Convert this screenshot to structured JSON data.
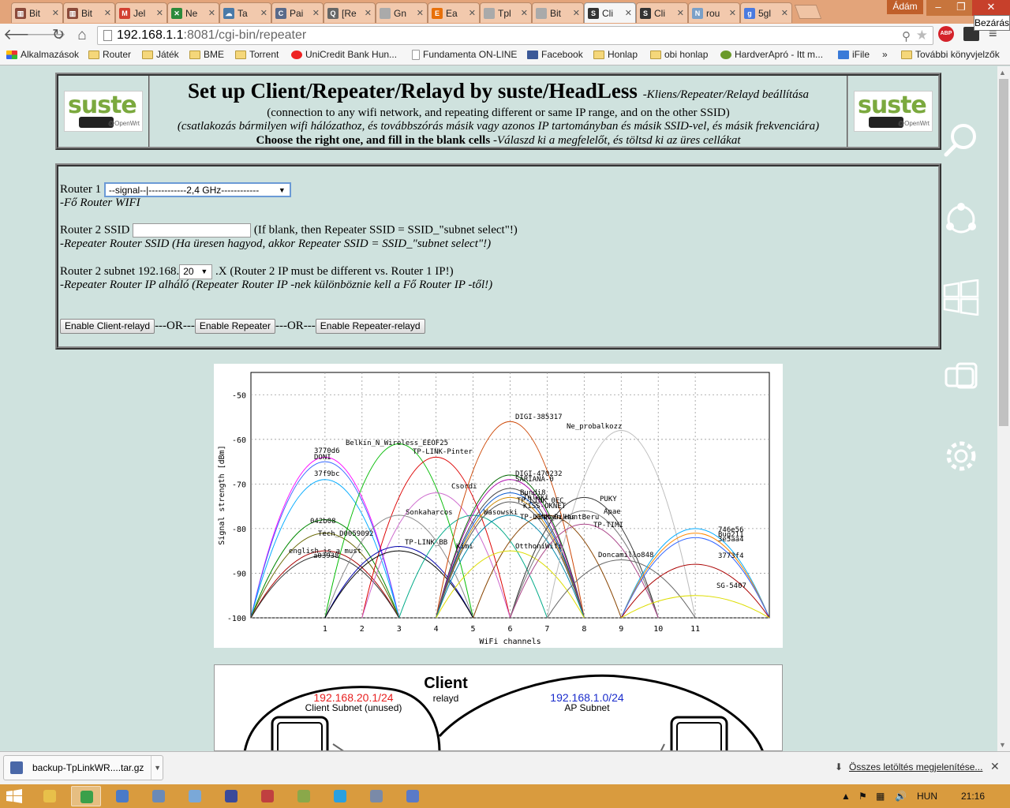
{
  "tabs": [
    {
      "label": "Bit",
      "color": "#8b4a3a",
      "glyph": "▥"
    },
    {
      "label": "Bit",
      "color": "#8b4a3a",
      "glyph": "▥"
    },
    {
      "label": "Jel",
      "color": "#d23f31",
      "glyph": "M"
    },
    {
      "label": "Ne",
      "color": "#2a8a3a",
      "glyph": "✕"
    },
    {
      "label": "Ta",
      "color": "#4a7aa8",
      "glyph": "☁"
    },
    {
      "label": "Pai",
      "color": "#5a6a8a",
      "glyph": "C"
    },
    {
      "label": "[Re",
      "color": "#666666",
      "glyph": "Q"
    },
    {
      "label": "Gn",
      "color": "#aaaaaa",
      "glyph": ""
    },
    {
      "label": "Ea",
      "color": "#e8700a",
      "glyph": "E"
    },
    {
      "label": "Tpl",
      "color": "#aaaaaa",
      "glyph": ""
    },
    {
      "label": "Bit",
      "color": "#aaaaaa",
      "glyph": ""
    },
    {
      "label": "Cli",
      "color": "#333333",
      "glyph": "S",
      "active": true
    },
    {
      "label": "Cli",
      "color": "#333333",
      "glyph": "S"
    },
    {
      "label": "rou",
      "color": "#7aa0c8",
      "glyph": "N"
    },
    {
      "label": "5gl",
      "color": "#4a7ae0",
      "glyph": "g"
    }
  ],
  "window": {
    "user": "Ádám",
    "close_tooltip": "Bezárás",
    "min": "–",
    "max": "❐",
    "close": "✕"
  },
  "toolbar": {
    "back": "🡐",
    "forward": "🡒",
    "reload": "↻",
    "home": "⌂",
    "url_host": "192.168.1.1",
    "url_rest": ":8081/cgi-bin/repeater",
    "abp": "ABP"
  },
  "bookmarks": [
    {
      "label": "Alkalmazások",
      "type": "apps"
    },
    {
      "label": "Router",
      "type": "folder"
    },
    {
      "label": "Játék",
      "type": "folder"
    },
    {
      "label": "BME",
      "type": "folder"
    },
    {
      "label": "Torrent",
      "type": "folder"
    },
    {
      "label": "UniCredit Bank Hun...",
      "type": "unicredit"
    },
    {
      "label": "Fundamenta ON-LINE",
      "type": "page"
    },
    {
      "label": "Facebook",
      "type": "facebook"
    },
    {
      "label": "Honlap",
      "type": "folder"
    },
    {
      "label": "obi honlap",
      "type": "folder"
    },
    {
      "label": "HardverApró - Itt m...",
      "type": "hardver"
    },
    {
      "label": "iFile",
      "type": "ifile"
    },
    {
      "label": "»",
      "type": "more"
    },
    {
      "label": "További könyvjelzők",
      "type": "folder"
    }
  ],
  "header": {
    "title": "Set up Client/Repeater/Relayd by suste/HeadLess",
    "title_sub": "-Kliens/Repeater/Relayd beállítása",
    "line1": "(connection to any wifi network, and repeating different or same IP range, and on the other SSID)",
    "line2": "(csatlakozás bármilyen wifi hálózathoz, és továbbszórás másik vagy azonos IP tartományban és másik SSID-vel, és másik frekvenciára)",
    "choose": "Choose the right one, and fill in the blank cells",
    "choose_sub": "-Válaszd ki a megfelelőt, és töltsd ki az üres cellákat",
    "logo_text": "suste",
    "logo_sub": "@OpenWrt"
  },
  "form": {
    "router1_label": "Router 1",
    "router1_value": "--signal--|------------2,4 GHz------------",
    "router1_hint": "-Fő Router WIFI",
    "ssid_label": "Router 2 SSID",
    "ssid_value": "",
    "ssid_note": "(If blank, then Repeater SSID = SSID_\"subnet select\"!)",
    "ssid_hint": "-Repeater Router SSID (Ha üresen hagyod, akkor Repeater SSID = SSID_\"subnet select\"!)",
    "subnet_label": "Router 2 subnet 192.168.",
    "subnet_value": "20",
    "subnet_note": ".X (Router 2 IP must be different vs. Router 1 IP!)",
    "subnet_hint": "-Repeater Router IP alháló (Repeater Router IP -nek különböznie kell a Fő Router IP -től!)",
    "btn_client": "Enable Client-relayd",
    "or1": "---OR---",
    "btn_repeater": "Enable Repeater",
    "or2": "---OR---",
    "btn_repeater_relayd": "Enable Repeater-relayd"
  },
  "chart_data": {
    "type": "line",
    "title": "",
    "xlabel": "WiFi channels",
    "ylabel": "Signal strength [dBm]",
    "xlim": [
      -1,
      13
    ],
    "ylim": [
      -100,
      -45
    ],
    "xticks": [
      1,
      2,
      3,
      4,
      5,
      6,
      7,
      8,
      9,
      10,
      11
    ],
    "yticks": [
      -50,
      -60,
      -70,
      -80,
      -90,
      -100
    ],
    "grid": true,
    "series": [
      {
        "name": "3770d6",
        "channel": 1,
        "peak": -64,
        "color": "#ff00ff"
      },
      {
        "name": "DONI",
        "channel": 1,
        "peak": -65,
        "color": "#3366ff"
      },
      {
        "name": "37f9bc",
        "channel": 1,
        "peak": -69,
        "color": "#00aaff"
      },
      {
        "name": "042b08",
        "channel": 1,
        "peak": -78,
        "color": "#008800"
      },
      {
        "name": "Tech_D0059092",
        "channel": 1,
        "peak": -81,
        "color": "#666600"
      },
      {
        "name": "english is a must",
        "channel": 1,
        "peak": -85,
        "color": "#aa0000"
      },
      {
        "name": "a03938",
        "channel": 1,
        "peak": -86,
        "color": "#333333"
      },
      {
        "name": "Belkin_N_Wireless_EEOF25",
        "channel": 3,
        "peak": -61,
        "color": "#00bb00"
      },
      {
        "name": "TP-LINK-Pinter",
        "channel": 4,
        "peak": -64,
        "color": "#dd0000"
      },
      {
        "name": "Csordi",
        "channel": 4,
        "peak": -72,
        "color": "#cc66cc"
      },
      {
        "name": "Sonkaharcos",
        "channel": 3,
        "peak": -77,
        "color": "#888888"
      },
      {
        "name": "TP-LINK_BB",
        "channel": 3,
        "peak": -84,
        "color": "#0000aa"
      },
      {
        "name": "Kimi",
        "channel": 3,
        "peak": -85,
        "color": "#000000"
      },
      {
        "name": "Wasowski",
        "channel": 5,
        "peak": -77,
        "color": "#00aa88"
      },
      {
        "name": "DIGI-385317",
        "channel": 6,
        "peak": -56,
        "color": "#cc4400"
      },
      {
        "name": "DIGI-470232",
        "channel": 6,
        "peak": -68,
        "color": "#006600"
      },
      {
        "name": "SARIANA-0",
        "channel": 6,
        "peak": -69,
        "color": "#aa00aa"
      },
      {
        "name": "Bundi8",
        "channel": 6,
        "peak": -71,
        "color": "#444444"
      },
      {
        "name": "Teleki",
        "channel": 6,
        "peak": -72,
        "color": "#0055cc"
      },
      {
        "name": "TP-LINK_0EC",
        "channel": 6,
        "peak": -73,
        "color": "#cc8800"
      },
      {
        "name": "KISS-OKNET",
        "channel": 6,
        "peak": -74,
        "color": "#555555"
      },
      {
        "name": "TP-LINK_Dikas",
        "channel": 6,
        "peak": -77,
        "color": "#0088aa"
      },
      {
        "name": "Kremen_HuntBeru",
        "channel": 7,
        "peak": -77,
        "color": "#884400"
      },
      {
        "name": "OtthoniWifi",
        "channel": 6,
        "peak": -85,
        "color": "#dddd00"
      },
      {
        "name": "Ne_probalkozz",
        "channel": 9,
        "peak": -58,
        "color": "#bbbbbb"
      },
      {
        "name": "PUKY",
        "channel": 8,
        "peak": -73,
        "color": "#333333"
      },
      {
        "name": "Apae",
        "channel": 8,
        "peak": -76,
        "color": "#777777"
      },
      {
        "name": "TP-TIMI",
        "channel": 8,
        "peak": -79,
        "color": "#aa4488"
      },
      {
        "name": "Doncamillo848",
        "channel": 9,
        "peak": -87,
        "color": "#666666"
      },
      {
        "name": "746e56",
        "channel": 11,
        "peak": -80,
        "color": "#00aaff"
      },
      {
        "name": "Bug211",
        "channel": 11,
        "peak": -81,
        "color": "#ff8800"
      },
      {
        "name": "3e5aa4",
        "channel": 11,
        "peak": -82,
        "color": "#3366ff"
      },
      {
        "name": "3773f4",
        "channel": 11,
        "peak": -88,
        "color": "#aa0000"
      },
      {
        "name": "SG-5407",
        "channel": 11,
        "peak": -95,
        "color": "#dddd00"
      }
    ]
  },
  "client_diagram": {
    "title": "Client",
    "relayd": "relayd",
    "left_ip": "192.168.20.1/24",
    "left_label": "Client Subnet (unused)",
    "right_ip": "192.168.1.0/24",
    "right_label": "AP Subnet",
    "left_color": "#e82020",
    "right_color": "#1a2ccc"
  },
  "downloads": {
    "file": "backup-TpLinkWR....tar.gz",
    "show_all": "Összes letöltés megjelenítése..."
  },
  "taskbar": {
    "lang": "HUN",
    "clock": "21:16"
  }
}
